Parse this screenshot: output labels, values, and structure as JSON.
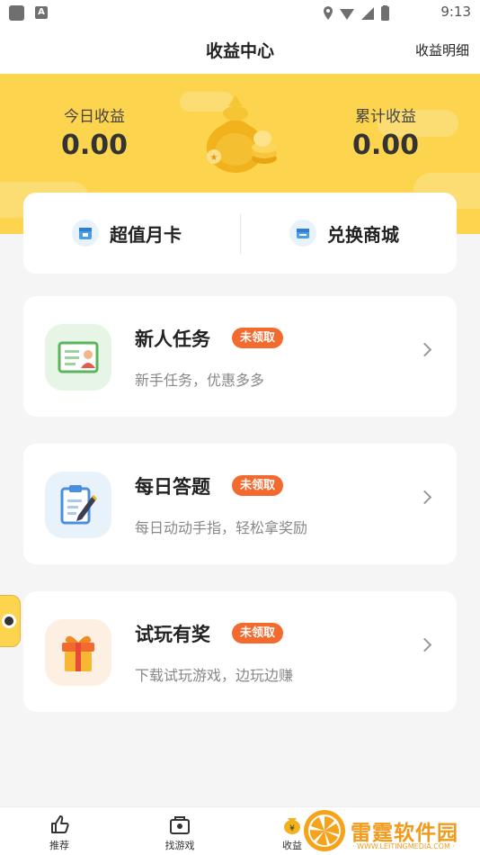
{
  "status_bar": {
    "time": "9:13"
  },
  "header": {
    "title": "收益中心",
    "detail_link": "收益明细"
  },
  "earnings": {
    "today": {
      "label": "今日收益",
      "value": "0.00"
    },
    "total": {
      "label": "累计收益",
      "value": "0.00"
    }
  },
  "quick_actions": [
    {
      "label": "超值月卡",
      "icon": "calendar-card-icon"
    },
    {
      "label": "兑换商城",
      "icon": "store-icon"
    }
  ],
  "tasks": [
    {
      "title": "新人任务",
      "badge": "未领取",
      "subtitle": "新手任务，优惠多多",
      "icon": "id-card-icon"
    },
    {
      "title": "每日答题",
      "badge": "未领取",
      "subtitle": "每日动动手指，轻松拿奖励",
      "icon": "clipboard-icon"
    },
    {
      "title": "试玩有奖",
      "badge": "未领取",
      "subtitle": "下载试玩游戏，边玩边赚",
      "icon": "gift-icon"
    }
  ],
  "bottom_nav": [
    {
      "label": "推荐",
      "icon": "thumbs-up-icon"
    },
    {
      "label": "找游戏",
      "icon": "game-box-icon"
    },
    {
      "label": "收益",
      "icon": "money-bag-icon"
    }
  ],
  "watermark": {
    "text": "雷霆软件园",
    "url": "· WWW.LEITINGMEDIA.COM ·"
  },
  "colors": {
    "accent_yellow": "#fcd44d",
    "badge_orange": "#f26a2e"
  }
}
